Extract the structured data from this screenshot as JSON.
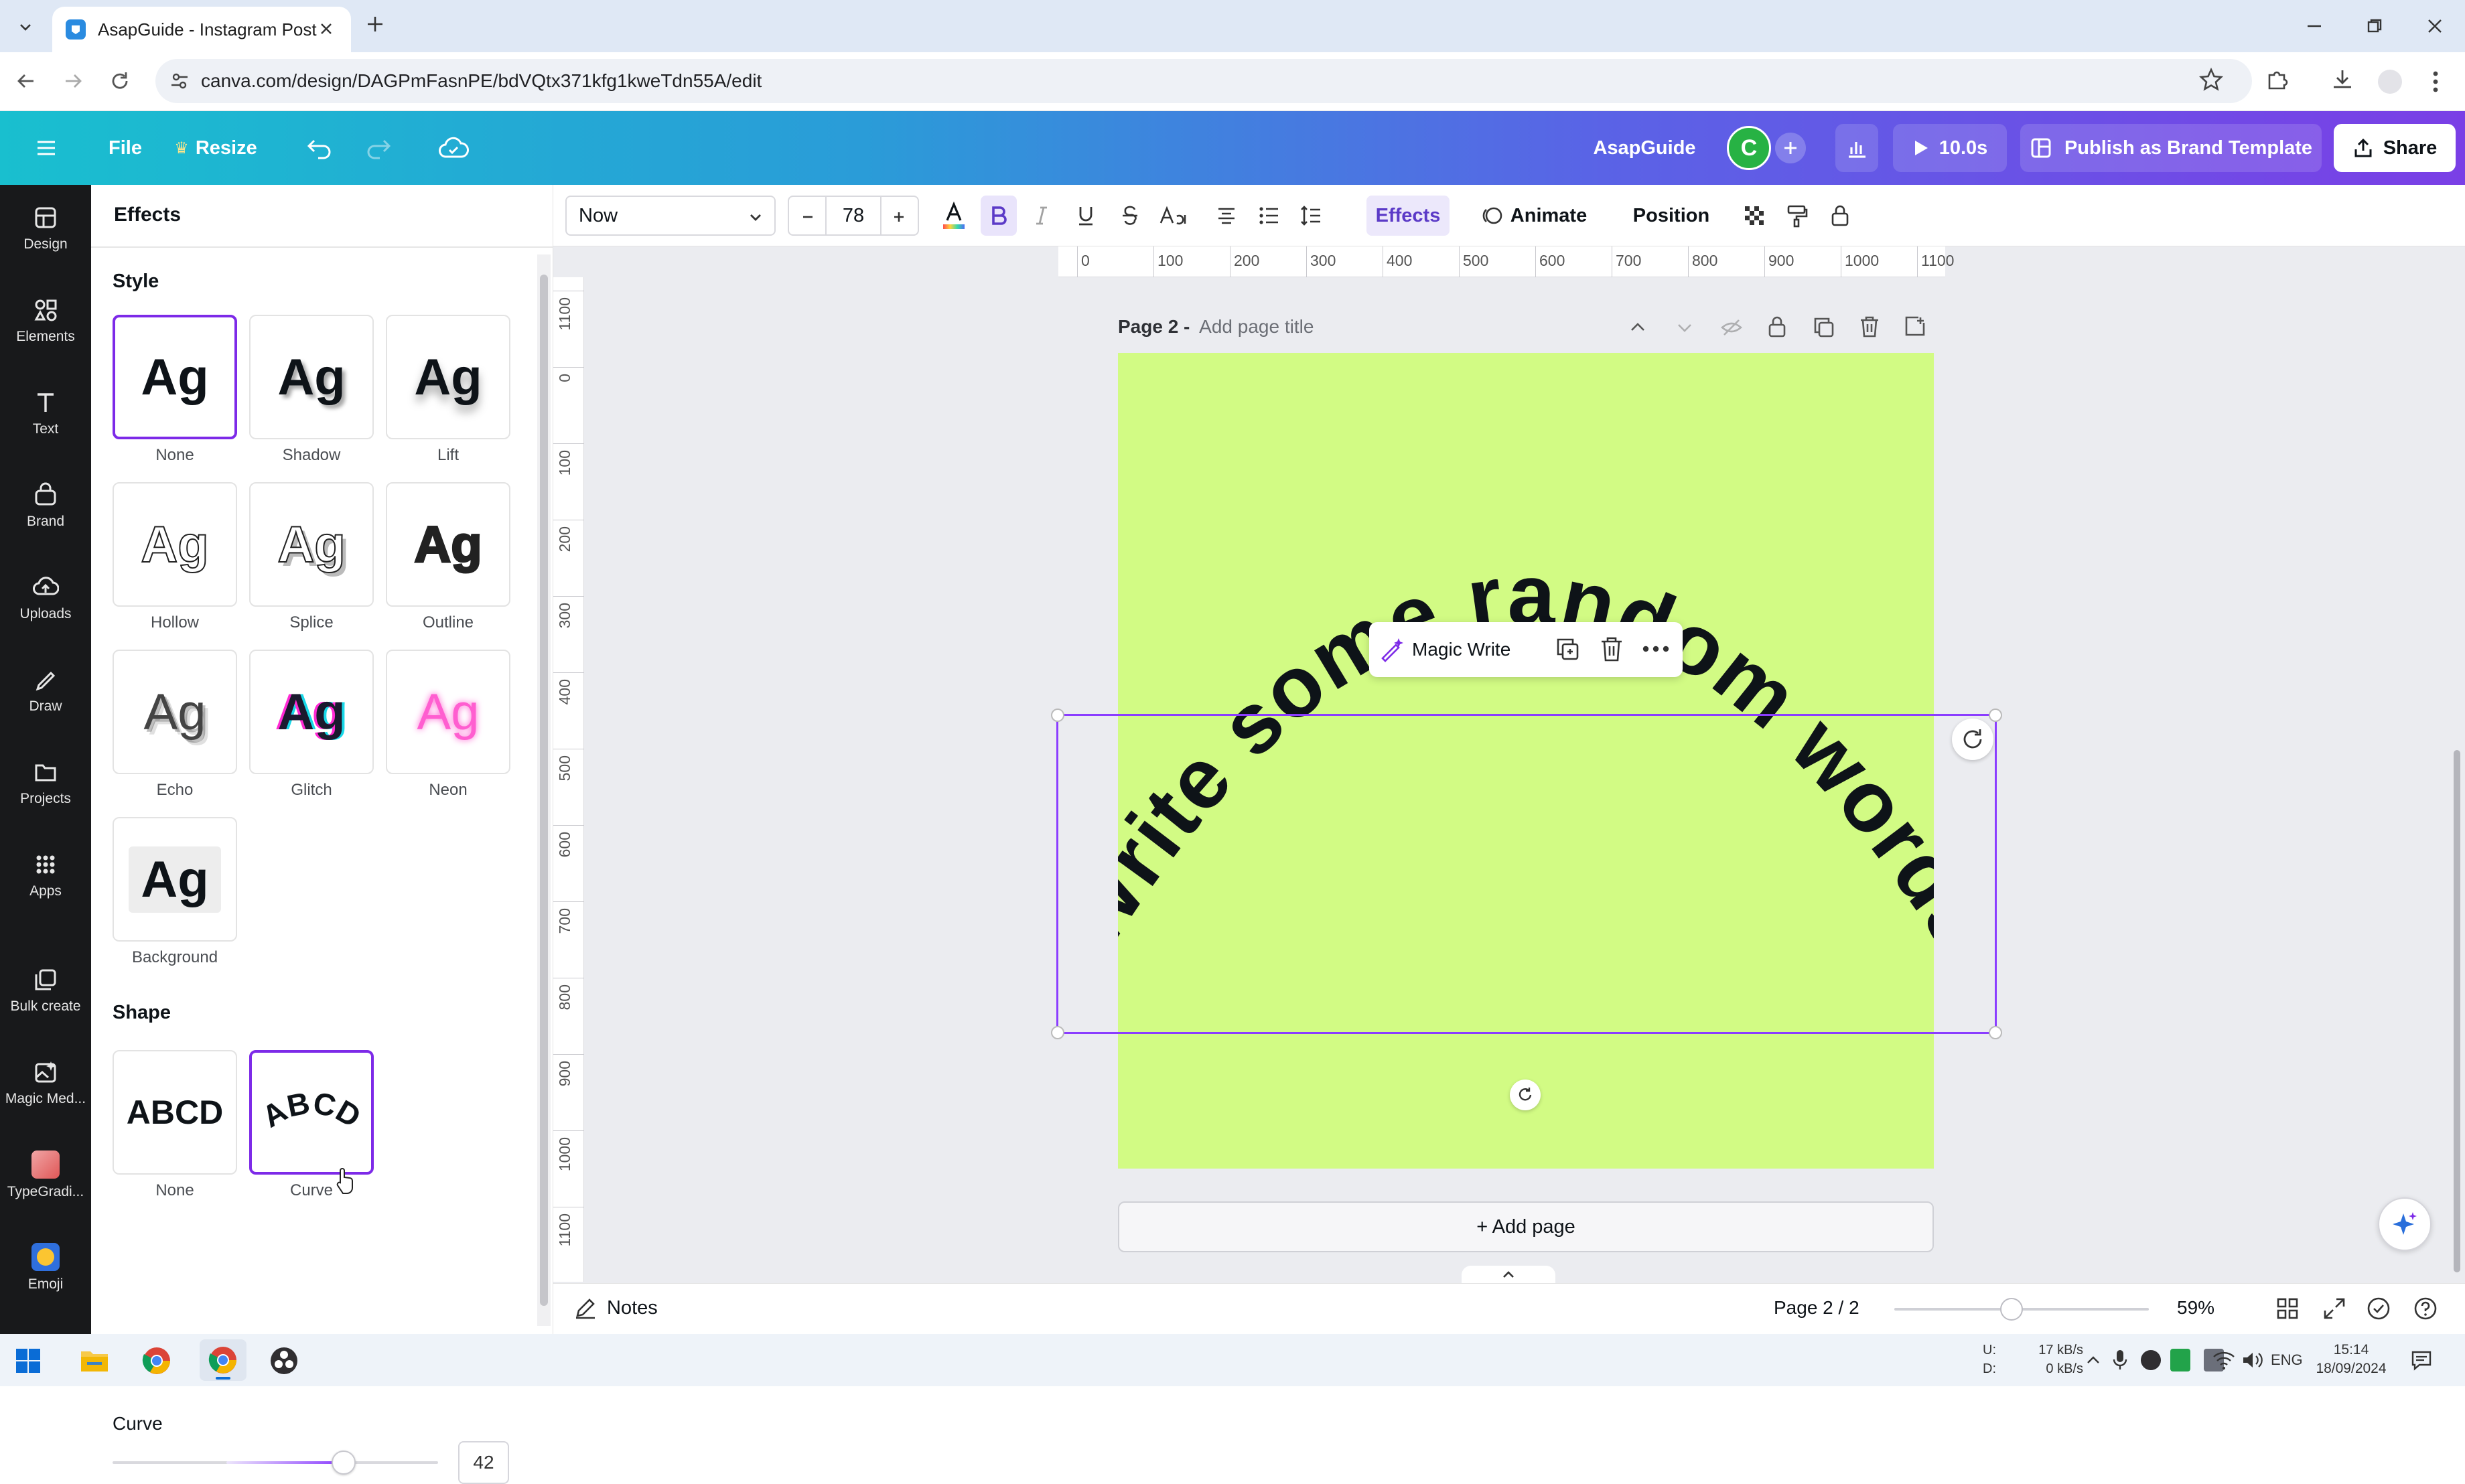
{
  "browser": {
    "tab_title": "AsapGuide - Instagram Post",
    "url": "canva.com/design/DAGPmFasnPE/bdVQtx371kfg1kweTdn55A/edit"
  },
  "header": {
    "file_label": "File",
    "resize_label": "Resize",
    "team_name": "AsapGuide",
    "avatar_letter": "C",
    "timer_label": "10.0s",
    "publish_label": "Publish as Brand Template",
    "share_label": "Share"
  },
  "rail": [
    {
      "label": "Design",
      "icon": "design-icon"
    },
    {
      "label": "Elements",
      "icon": "elements-icon"
    },
    {
      "label": "Text",
      "icon": "text-icon"
    },
    {
      "label": "Brand",
      "icon": "brand-icon"
    },
    {
      "label": "Uploads",
      "icon": "uploads-icon"
    },
    {
      "label": "Draw",
      "icon": "draw-icon"
    },
    {
      "label": "Projects",
      "icon": "projects-icon"
    },
    {
      "label": "Apps",
      "icon": "apps-icon"
    },
    {
      "label": "Bulk create",
      "icon": "bulk-create-icon"
    },
    {
      "label": "Magic Med...",
      "icon": "magic-media-icon"
    },
    {
      "label": "TypeGradi...",
      "icon": "typegradient-icon"
    },
    {
      "label": "Emoji",
      "icon": "emoji-icon"
    }
  ],
  "panel": {
    "title": "Effects",
    "style_heading": "Style",
    "tile_text": "Ag",
    "styles": [
      "None",
      "Shadow",
      "Lift",
      "Hollow",
      "Splice",
      "Outline",
      "Echo",
      "Glitch",
      "Neon",
      "Background"
    ],
    "selected_style": "None",
    "shape_heading": "Shape",
    "shape_tile_text": "ABCD",
    "shapes": [
      "None",
      "Curve"
    ],
    "selected_shape": "Curve",
    "curve_label": "Curve",
    "curve_value": "42",
    "curve_fraction": 0.71
  },
  "toolbar": {
    "font_name": "Now",
    "font_size": "78",
    "effects_label": "Effects",
    "animate_label": "Animate",
    "position_label": "Position"
  },
  "ruler": {
    "h_ticks": [
      "0",
      "100",
      "200",
      "300",
      "400",
      "500",
      "600",
      "700",
      "800",
      "900",
      "1000",
      "1100"
    ],
    "v_ticks": [
      "1100",
      "0",
      "100",
      "200",
      "300",
      "400",
      "500",
      "600",
      "700",
      "800",
      "900",
      "1000",
      "1100"
    ]
  },
  "canvas": {
    "page_label": "Page 2 -",
    "page_title_placeholder": "Add page title",
    "curved_text": "Write some random words",
    "magic_write_label": "Magic Write",
    "add_page_label": "+ Add page",
    "page_color": "#d2fb84"
  },
  "bottombar": {
    "notes_label": "Notes",
    "page_indicator": "Page 2 / 2",
    "zoom": "59%",
    "zoom_fraction": 0.46
  },
  "taskbar": {
    "net_up": "17 kB/s",
    "net_down": "0 kB/s",
    "net_up_label": "U:",
    "net_down_label": "D:",
    "lang": "ENG",
    "time": "15:14",
    "date": "18/09/2024"
  },
  "colors": {
    "accent": "#7d2ae8",
    "selection": "#8b3dff"
  }
}
